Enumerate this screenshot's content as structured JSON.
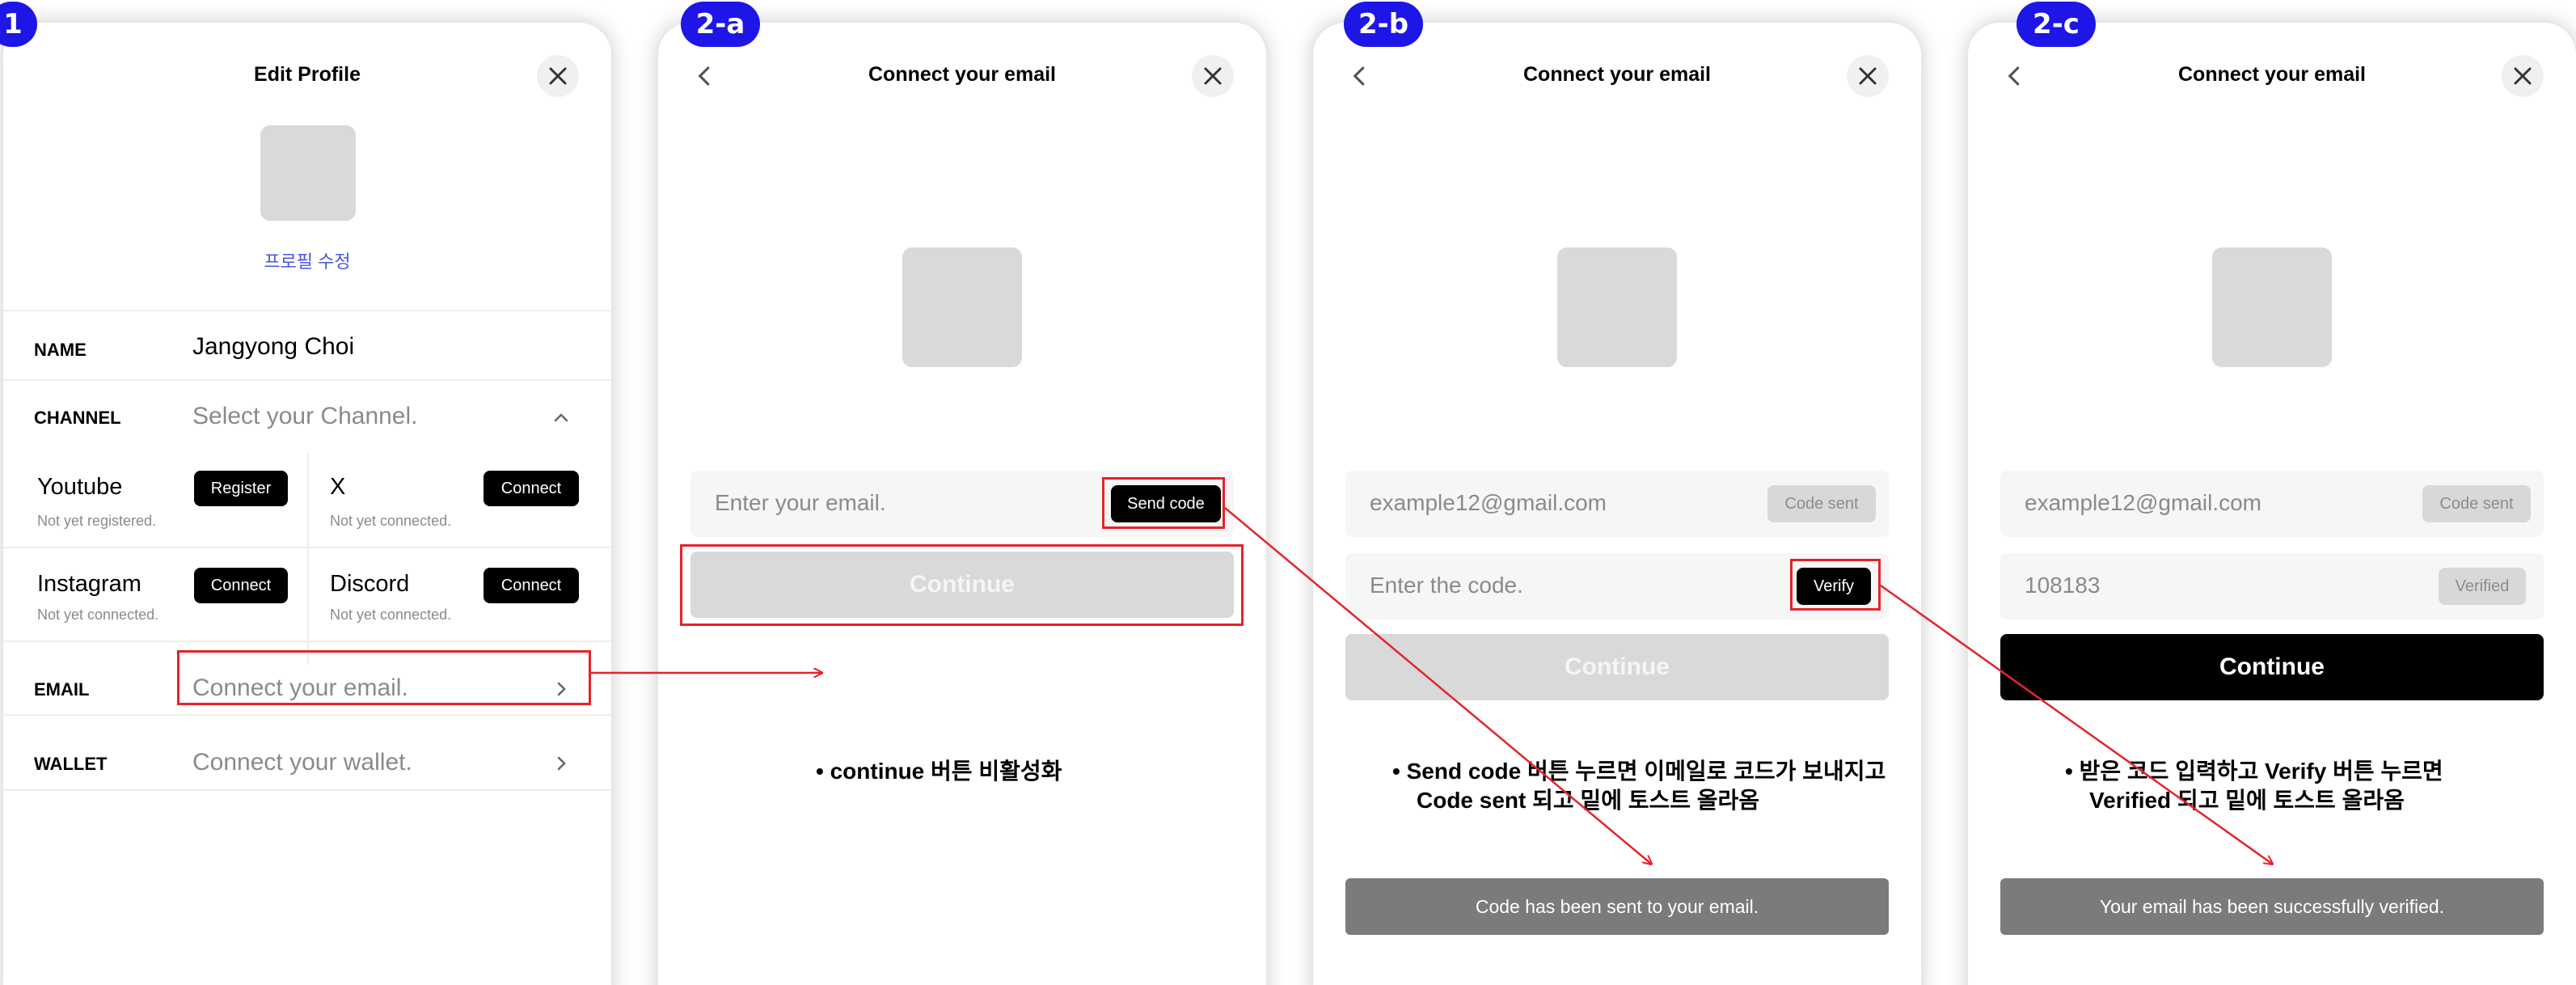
{
  "badges": [
    "1",
    "2-a",
    "2-b",
    "2-c"
  ],
  "colors": {
    "badge": "#1d16e6",
    "highlight": "#e5232a",
    "link": "#4a56e2",
    "toast": "#7b7b7b"
  },
  "icons": {
    "close": "close-icon",
    "back": "chevron-left-icon",
    "expand": "chevron-up-icon",
    "row": "chevron-right-icon"
  },
  "edit_profile": {
    "title": "Edit Profile",
    "profile_link": "프로필 수정",
    "name": {
      "label": "NAME",
      "value": "Jangyong Choi"
    },
    "channel": {
      "label": "CHANNEL",
      "placeholder": "Select your Channel."
    },
    "channels": [
      {
        "name": "Youtube",
        "status": "Not yet registered.",
        "button": "Register"
      },
      {
        "name": "X",
        "status": "Not yet connected.",
        "button": "Connect"
      },
      {
        "name": "Instagram",
        "status": "Not yet connected.",
        "button": "Connect"
      },
      {
        "name": "Discord",
        "status": "Not yet connected.",
        "button": "Connect"
      }
    ],
    "email": {
      "label": "EMAIL",
      "placeholder": "Connect your email."
    },
    "wallet": {
      "label": "WALLET",
      "placeholder": "Connect your wallet."
    }
  },
  "connect_email_a": {
    "title": "Connect your email",
    "email_placeholder": "Enter your email.",
    "send_code": "Send code",
    "continue": "Continue",
    "note": "continue 버튼 비활성화"
  },
  "connect_email_b": {
    "title": "Connect your email",
    "email_value": "example12@gmail.com",
    "code_sent": "Code sent",
    "code_placeholder": "Enter the code.",
    "verify": "Verify",
    "continue": "Continue",
    "note_line1": "Send code 버튼 누르면 이메일로 코드가 보내지고",
    "note_line2": "Code sent 되고 밑에 토스트 올라옴",
    "toast": "Code has been sent to your email."
  },
  "connect_email_c": {
    "title": "Connect your email",
    "email_value": "example12@gmail.com",
    "code_sent": "Code sent",
    "code_value": "108183",
    "verified": "Verified",
    "continue": "Continue",
    "note_line1": "받은 코드 입력하고 Verify 버튼 누르면",
    "note_line2": "Verified 되고 밑에 토스트 올라옴",
    "toast": "Your email has been successfully verified."
  }
}
